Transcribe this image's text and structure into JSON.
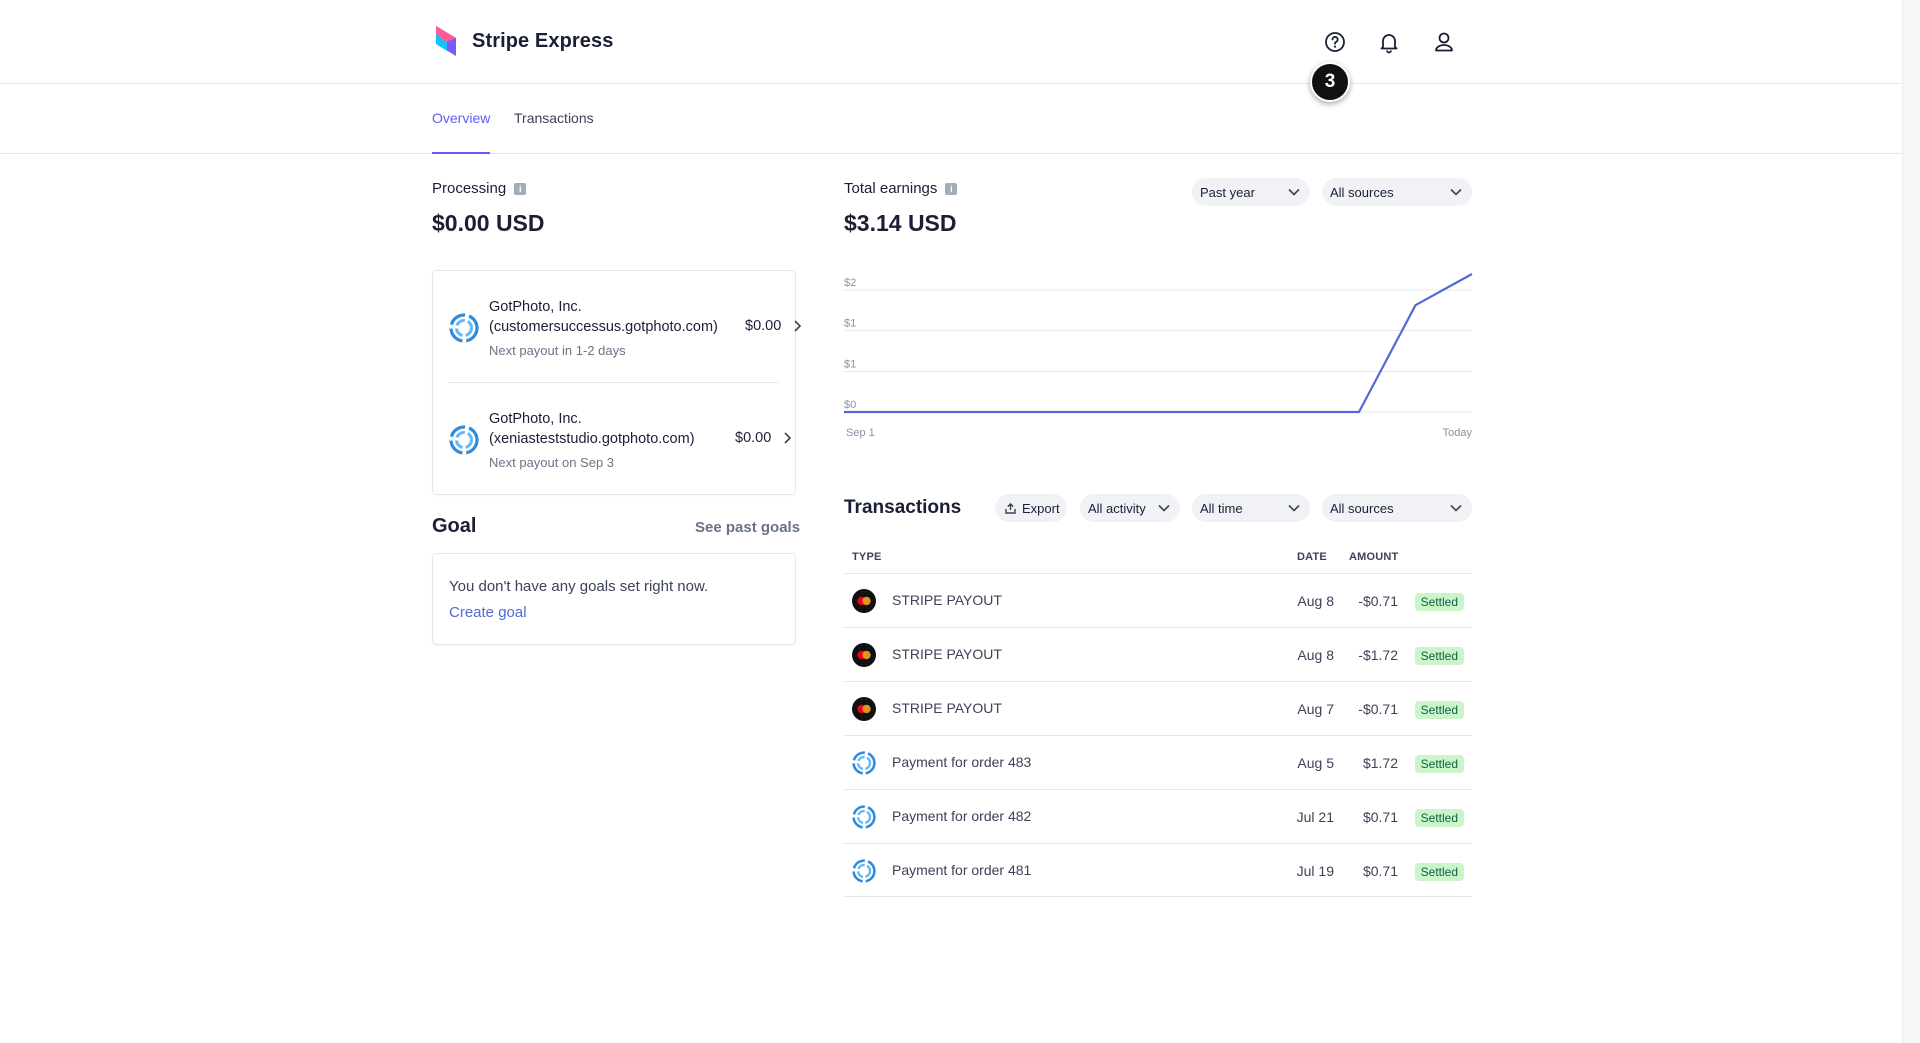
{
  "header": {
    "brand": "Stripe Express",
    "step_badge": "3",
    "icons": [
      "help-icon",
      "bell-icon",
      "user-icon"
    ]
  },
  "tabs": [
    {
      "label": "Overview",
      "active": true
    },
    {
      "label": "Transactions",
      "active": false
    }
  ],
  "processing": {
    "title": "Processing",
    "amount": "$0.00 USD",
    "payouts": [
      {
        "name": "GotPhoto, Inc. (customersuccessus.gotphoto.com)",
        "amount": "$0.00",
        "subtitle": "Next payout in 1-2 days"
      },
      {
        "name": "GotPhoto, Inc. (xeniasteststudio.gotphoto.com)",
        "amount": "$0.00",
        "subtitle": "Next payout on Sep 3"
      }
    ]
  },
  "goal": {
    "title": "Goal",
    "see_past": "See past goals",
    "empty_text": "You don't have any goals set right now.",
    "create_label": "Create goal"
  },
  "earnings": {
    "title": "Total earnings",
    "amount": "$3.14 USD",
    "period_filter": "Past year",
    "source_filter": "All sources"
  },
  "chart_data": {
    "type": "line",
    "x_labels": [
      "Sep 1",
      "Today"
    ],
    "y_tick_labels": [
      "$2",
      "$1",
      "$1",
      "$0"
    ],
    "series": [
      {
        "x": [
          0,
          0.82,
          0.91,
          1.0
        ],
        "values": [
          0,
          0,
          2.43,
          3.14
        ]
      }
    ],
    "ylim": [
      0,
      3.14
    ],
    "grid": true,
    "color": "#5469d4"
  },
  "transactions": {
    "title": "Transactions",
    "export_label": "Export",
    "filters": {
      "activity": "All activity",
      "time": "All time",
      "sources": "All sources"
    },
    "columns": {
      "type": "TYPE",
      "date": "DATE",
      "amount": "AMOUNT"
    },
    "rows": [
      {
        "type": "STRIPE PAYOUT",
        "date": "Aug 8",
        "amount": "-$0.71",
        "status": "Settled",
        "icon": "mastercard-icon"
      },
      {
        "type": "STRIPE PAYOUT",
        "date": "Aug 8",
        "amount": "-$1.72",
        "status": "Settled",
        "icon": "mastercard-icon"
      },
      {
        "type": "STRIPE PAYOUT",
        "date": "Aug 7",
        "amount": "-$0.71",
        "status": "Settled",
        "icon": "mastercard-icon"
      },
      {
        "type": "Payment for order 483",
        "date": "Aug 5",
        "amount": "$1.72",
        "status": "Settled",
        "icon": "gotphoto-icon"
      },
      {
        "type": "Payment for order 482",
        "date": "Jul 21",
        "amount": "$0.71",
        "status": "Settled",
        "icon": "gotphoto-icon"
      },
      {
        "type": "Payment for order 481",
        "date": "Jul 19",
        "amount": "$0.71",
        "status": "Settled",
        "icon": "gotphoto-icon"
      }
    ]
  },
  "colors": {
    "accent": "#635bff",
    "link": "#5469d4",
    "settled_bg": "#cbf4c9",
    "settled_text": "#0e6245"
  }
}
